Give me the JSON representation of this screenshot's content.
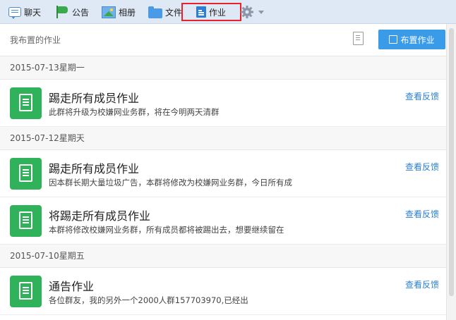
{
  "toolbar": {
    "tabs": [
      {
        "label": "聊天",
        "icon": "chat-icon"
      },
      {
        "label": "公告",
        "icon": "flag-icon"
      },
      {
        "label": "相册",
        "icon": "album-icon"
      },
      {
        "label": "文件",
        "icon": "folder-icon"
      },
      {
        "label": "作业",
        "icon": "homework-icon",
        "selected": true
      }
    ],
    "settings_icon": "gear-icon"
  },
  "header": {
    "title": "我布置的作业",
    "post_button": "布置作业"
  },
  "groups": [
    {
      "date": "2015-07-13星期一",
      "items": [
        {
          "title": "踢走所有成员作业",
          "desc": "此群将升级为校嫌网业务群，将在今明两天清群",
          "action": "查看反馈"
        }
      ]
    },
    {
      "date": "2015-07-12星期天",
      "items": [
        {
          "title": "踢走所有成员作业",
          "desc": "因本群长期大量垃圾广告，本群将修改为校嫌网业务群，今日所有成",
          "action": "查看反馈"
        },
        {
          "title": "将踢走所有成员作业",
          "desc": "本群将修改校嫌网业务群，所有成员都将被踢出去，想要继续留在",
          "action": "查看反馈"
        }
      ]
    },
    {
      "date": "2015-07-10星期五",
      "items": [
        {
          "title": "通告作业",
          "desc": "各位群友，我的另外一个2000人群157703970,已经出",
          "action": "查看反馈"
        }
      ]
    }
  ],
  "colors": {
    "accent": "#3a9be9",
    "homework_icon": "#2fb25a",
    "link": "#2a7fd1",
    "highlight_box": "#e8212b"
  }
}
